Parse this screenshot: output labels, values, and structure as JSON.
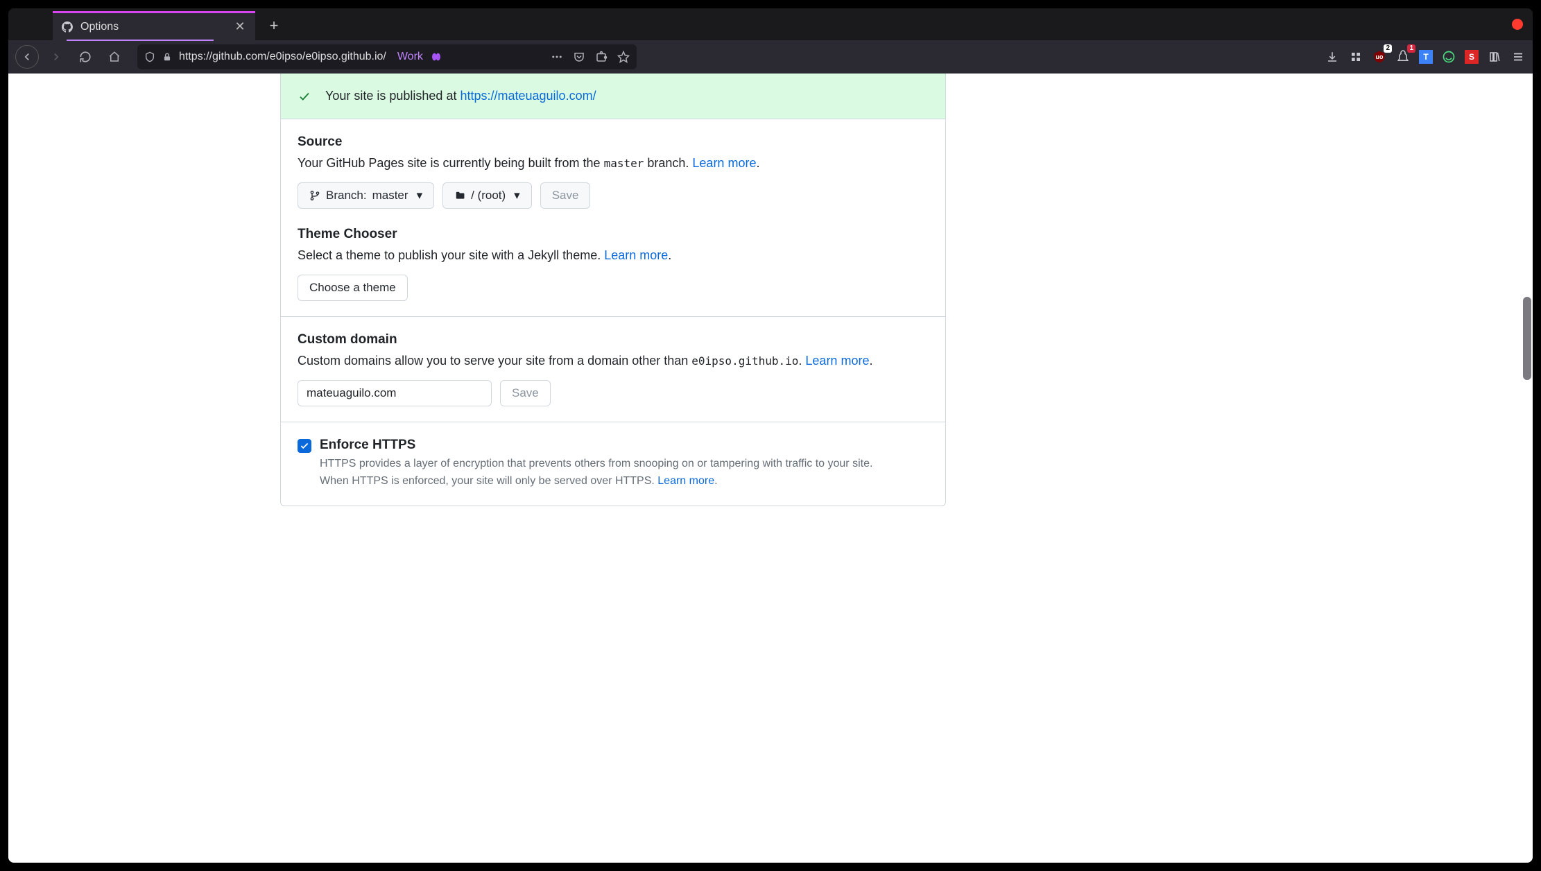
{
  "browser": {
    "tab_title": "Options",
    "url_display": "https://github.com/e0ipso/e0ipso.github.io/",
    "container_label": "Work",
    "ext_badges": {
      "ubo": "2",
      "bell": "1"
    }
  },
  "flash": {
    "prefix": "Your site is published at ",
    "link": "https://mateuaguilo.com/"
  },
  "source": {
    "heading": "Source",
    "desc_pre": "Your GitHub Pages site is currently being built from the ",
    "branch_code": "master",
    "desc_post": " branch. ",
    "learn_more": "Learn more",
    "branch_label": "Branch: ",
    "branch_value": "master",
    "folder_value": "/ (root)",
    "save": "Save"
  },
  "theme": {
    "heading": "Theme Chooser",
    "desc": "Select a theme to publish your site with a Jekyll theme. ",
    "learn_more": "Learn more",
    "button": "Choose a theme"
  },
  "domain": {
    "heading": "Custom domain",
    "desc_pre": "Custom domains allow you to serve your site from a domain other than ",
    "code": "e0ipso.github.io",
    "desc_post": ". ",
    "learn_more": "Learn more",
    "input_value": "mateuaguilo.com",
    "save": "Save"
  },
  "https": {
    "heading": "Enforce HTTPS",
    "line1": "HTTPS provides a layer of encryption that prevents others from snooping on or tampering with traffic to your site.",
    "line2_pre": "When HTTPS is enforced, your site will only be served over HTTPS. ",
    "learn_more": "Learn more"
  }
}
